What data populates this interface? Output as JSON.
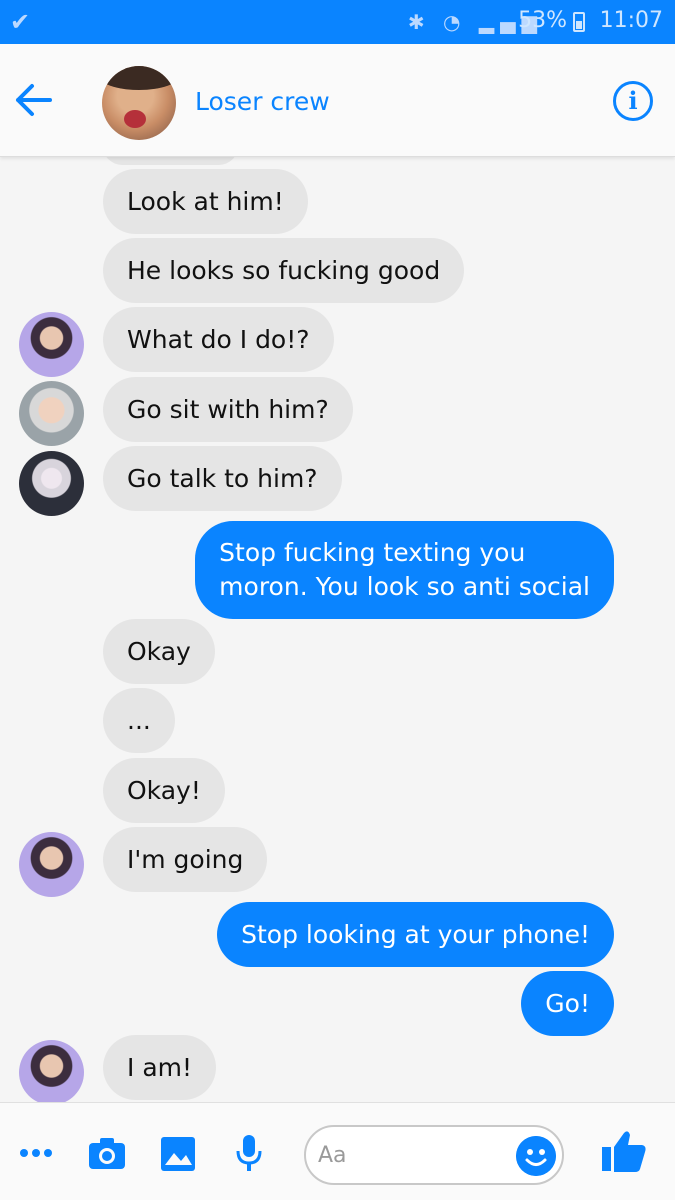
{
  "status_bar": {
    "battery": "53%",
    "time": "11:07"
  },
  "header": {
    "title": "Loser crew",
    "info_label": "i"
  },
  "messages": [
    {
      "side": "in",
      "text": "Look at him!"
    },
    {
      "side": "in",
      "text": "He looks so fucking good"
    },
    {
      "side": "in",
      "text": "What do I do!?"
    },
    {
      "side": "in",
      "text": "Go sit with him?"
    },
    {
      "side": "in",
      "text": "Go talk to him?"
    },
    {
      "side": "out",
      "lines": [
        "Stop fucking texting you",
        "moron. You look so anti social"
      ]
    },
    {
      "side": "in",
      "text": "Okay"
    },
    {
      "side": "in",
      "text": "..."
    },
    {
      "side": "in",
      "text": "Okay!"
    },
    {
      "side": "in",
      "text": "I'm going"
    },
    {
      "side": "out",
      "text": "Stop looking at your phone!"
    },
    {
      "side": "out",
      "text": "Go!"
    },
    {
      "side": "in",
      "text": "I am!"
    }
  ],
  "composer": {
    "placeholder": "Aa"
  },
  "colors": {
    "accent": "#0a84ff",
    "incoming_bubble": "#e5e5e5",
    "status_bar": "#0a84ff"
  },
  "toolbar_icons": [
    "more-icon",
    "camera-icon",
    "gallery-icon",
    "microphone-icon",
    "emoji-icon",
    "like-icon"
  ]
}
